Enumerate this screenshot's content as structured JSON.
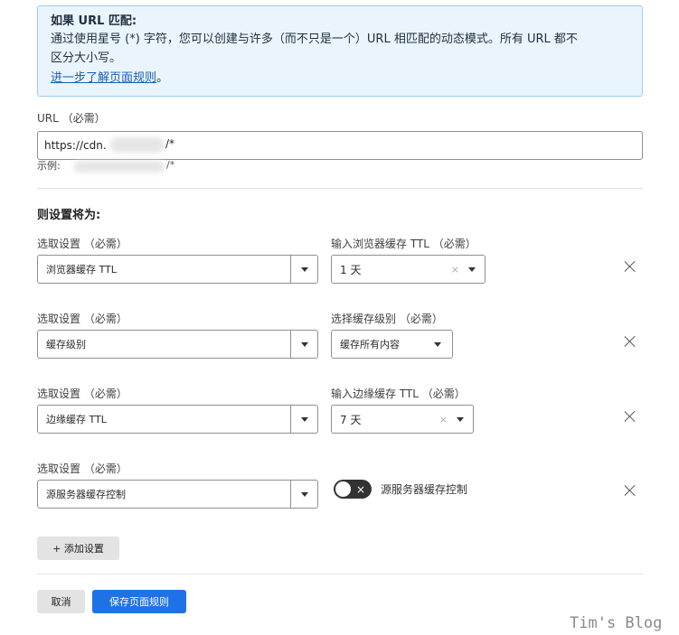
{
  "info": {
    "title": "如果 URL 匹配:",
    "line1": "通过使用星号 (*) 字符，您可以创建与许多（而不只是一个）URL 相匹配的动态模式。所有 URL 都不",
    "line2": "区分大小写。",
    "link": "进一步了解页面规则",
    "link_suffix": "。"
  },
  "url": {
    "label": "URL （必需）",
    "value": "https://cdn.",
    "suffix": "/*",
    "example_label": "示例:",
    "example_suffix": "/*"
  },
  "settings_title": "则设置将为:",
  "rows": [
    {
      "select_label": "选取设置 （必需）",
      "select_value": "浏览器缓存 TTL",
      "value_label": "输入浏览器缓存 TTL （必需）",
      "value": "1 天",
      "clear": "×"
    },
    {
      "select_label": "选取设置 （必需）",
      "select_value": "缓存级别",
      "value_label": "选择缓存级别 （必需）",
      "value": "缓存所有内容"
    },
    {
      "select_label": "选取设置 （必需）",
      "select_value": "边缘缓存 TTL",
      "value_label": "输入边缘缓存 TTL （必需）",
      "value": "7 天",
      "clear": "×"
    },
    {
      "select_label": "选取设置 （必需）",
      "select_value": "源服务器缓存控制",
      "toggle_icon": "×",
      "toggle_label": "源服务器缓存控制"
    }
  ],
  "add_setting": "+ 添加设置",
  "cancel": "取消",
  "save": "保存页面规则",
  "watermark": "Tim's Blog"
}
